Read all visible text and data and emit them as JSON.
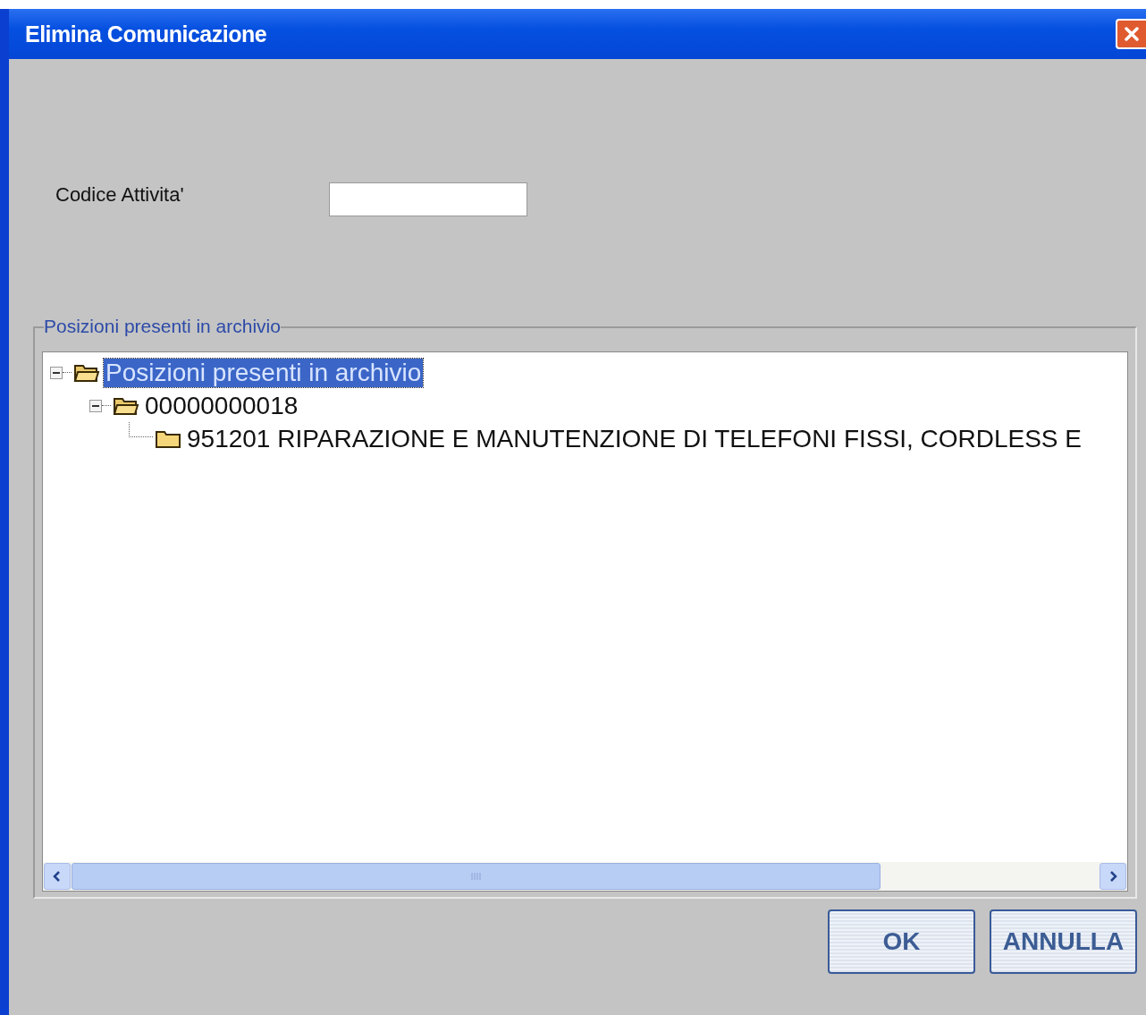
{
  "window": {
    "title": "Elimina Comunicazione"
  },
  "form": {
    "label": "Codice Attivita'"
  },
  "group": {
    "title": "Posizioni presenti in archivio"
  },
  "tree": [
    {
      "label": "Posizioni presenti in archivio",
      "expanded": true,
      "selected": true,
      "children": [
        {
          "label": "00000000018",
          "expanded": true,
          "selected": false,
          "children": [
            {
              "label": "951201 RIPARAZIONE E MANUTENZIONE DI TELEFONI FISSI, CORDLESS E",
              "selected": false
            }
          ]
        }
      ]
    }
  ],
  "buttons": [
    "OK",
    "ANNULLA"
  ]
}
